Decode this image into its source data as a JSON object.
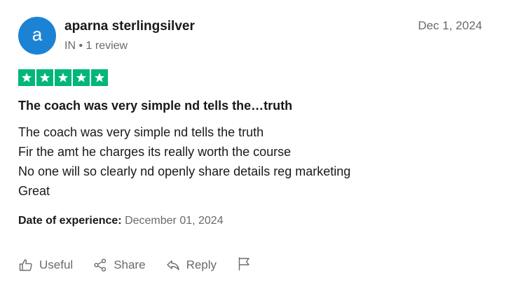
{
  "reviewer": {
    "avatar_letter": "a",
    "avatar_color": "#1c83d4",
    "name": "aparna sterlingsilver",
    "meta": "IN • 1 review"
  },
  "review": {
    "date": "Dec 1, 2024",
    "rating": 5,
    "rating_max": 5,
    "star_color": "#00b67a",
    "title": "The coach was very simple nd tells the…truth",
    "body_lines": [
      "The coach was very simple nd tells the truth",
      "Fir the amt he charges its really worth the course",
      "No one will so clearly nd openly share details reg marketing",
      "Great"
    ],
    "experience_label": "Date of experience:",
    "experience_date": "December 01, 2024"
  },
  "actions": {
    "useful_label": "Useful",
    "useful_icon": "thumbs-up-icon",
    "share_label": "Share",
    "share_icon": "share-icon",
    "reply_label": "Reply",
    "reply_icon": "reply-icon",
    "flag_icon": "flag-icon"
  }
}
